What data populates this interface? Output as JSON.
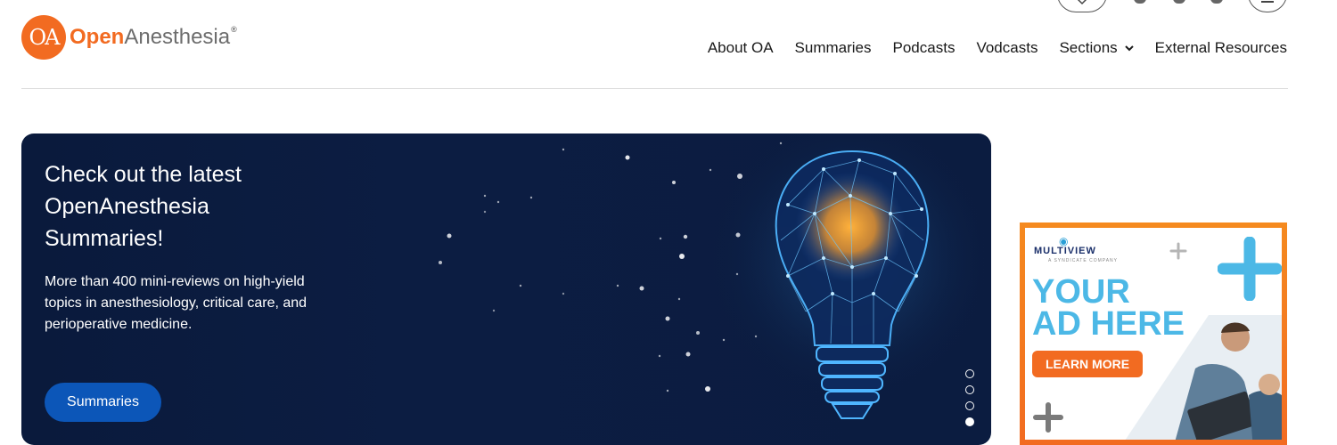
{
  "brand": {
    "logo_mark": "OA",
    "name_part1": "Open",
    "name_part2": "Anesthesia",
    "registered": "®"
  },
  "header_icons": [
    "search-icon",
    "facebook-icon",
    "twitter-icon",
    "instagram-icon",
    "menu-icon"
  ],
  "nav": {
    "items": [
      {
        "label": "About OA"
      },
      {
        "label": "Summaries"
      },
      {
        "label": "Podcasts"
      },
      {
        "label": "Vodcasts"
      },
      {
        "label": "Sections",
        "has_dropdown": true
      },
      {
        "label": "External Resources"
      }
    ]
  },
  "hero": {
    "title": "Check out the latest OpenAnesthesia Summaries!",
    "description": "More than 400 mini-reviews on high-yield topics in anesthesiology, critical care, and perioperative medicine.",
    "button_label": "Summaries",
    "slide_count": 4,
    "active_slide": 4,
    "background_color": "#0b1c40",
    "button_color": "#0c56b8"
  },
  "ad": {
    "brand": "MULTIVIEW",
    "brand_sub": "A SYNDICATE COMPANY",
    "headline_line1": "YOUR",
    "headline_line2": "AD HERE",
    "button_label": "LEARN MORE",
    "border_color": "#f26b21",
    "headline_color": "#4cb8e6"
  }
}
